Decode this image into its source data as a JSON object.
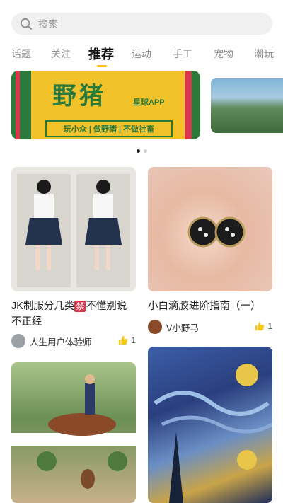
{
  "search": {
    "placeholder": "搜索"
  },
  "tabs": [
    {
      "label": "话题"
    },
    {
      "label": "关注"
    },
    {
      "label": "推荐",
      "active": true
    },
    {
      "label": "运动"
    },
    {
      "label": "手工"
    },
    {
      "label": "宠物"
    },
    {
      "label": "潮玩"
    }
  ],
  "banner": {
    "title": "野猪",
    "app": "星球APP",
    "slogan": "玩小众 | 做野猪 | 不做社畜"
  },
  "carousel": {
    "page": 1,
    "total": 2
  },
  "cards": [
    {
      "caption_pre": "JK制服分几类",
      "caption_tag": "禁",
      "caption_post": "不懂别说不正经",
      "author": "人生用户体验师",
      "likes": "1"
    },
    {
      "caption_pre": "小白滴胶进阶指南（一）",
      "caption_tag": "",
      "caption_post": "",
      "author": "V小野马",
      "likes": "1"
    }
  ],
  "colors": {
    "accent": "#f5c518",
    "banner_green": "#2c7a3b",
    "banner_yellow": "#f2c22a",
    "tag_red": "#d9374b"
  }
}
